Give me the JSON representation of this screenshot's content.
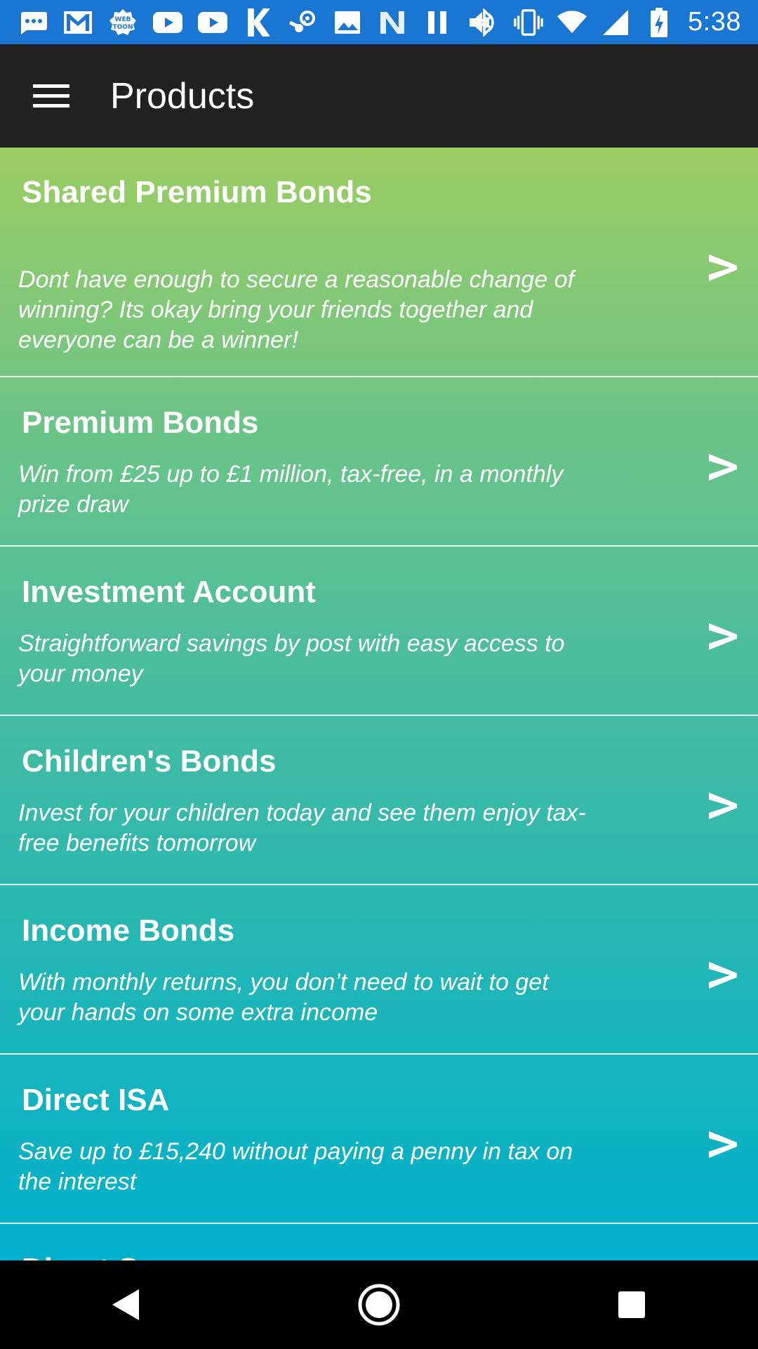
{
  "status_bar": {
    "time": "5:38",
    "left_icons": [
      "messaging-icon",
      "gmail-icon",
      "webtoon-icon",
      "youtube-icon",
      "youtube-icon",
      "kindle-icon",
      "steam-icon",
      "photos-icon",
      "nfc-icon",
      "pause-icon",
      "volume-icon"
    ],
    "right_icons": [
      "bluetooth-icon",
      "vibrate-icon",
      "wifi-icon",
      "cell-signal-icon",
      "battery-charging-icon"
    ]
  },
  "appbar": {
    "title": "Products"
  },
  "products": [
    {
      "title": "Shared Premium Bonds",
      "description": "Dont have enough to secure a reasonable change of winning? Its okay bring your friends together and everyone can be a winner!"
    },
    {
      "title": "Premium Bonds",
      "description": "Win from £25 up to £1 million, tax-free, in a monthly prize draw"
    },
    {
      "title": "Investment Account",
      "description": "Straightforward savings by post with easy access to your money"
    },
    {
      "title": "Children's Bonds",
      "description": "Invest for your children today and see them enjoy tax-free benefits tomorrow"
    },
    {
      "title": "Income Bonds",
      "description": "With monthly returns, you don’t need to wait to get your hands on some extra income"
    },
    {
      "title": "Direct ISA",
      "description": "Save up to £15,240 without paying a penny in tax on the interest"
    },
    {
      "title": "Direct S",
      "description": ""
    }
  ],
  "colors": {
    "status_bar": "#1976d2",
    "app_bar": "#212121",
    "gradient_top": "#9ccd62",
    "gradient_bottom": "#00b0cc"
  }
}
